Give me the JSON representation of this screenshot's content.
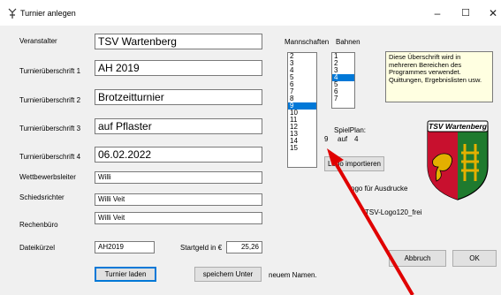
{
  "window": {
    "title": "Turnier anlegen",
    "min_glyph": "–",
    "max_glyph": "☐",
    "close_glyph": "✕"
  },
  "form": {
    "veranstalter": {
      "label": "Veranstalter",
      "value": "TSV Wartenberg"
    },
    "ueberschrift1": {
      "label": "Turnierüberschrift 1",
      "value": "AH 2019"
    },
    "ueberschrift2": {
      "label": "Turnierüberschrift 2",
      "value": "Brotzeitturnier"
    },
    "ueberschrift3": {
      "label": "Turnierüberschrift 3",
      "value": "auf Pflaster"
    },
    "ueberschrift4": {
      "label": "Turnierüberschrift 4",
      "value": "06.02.2022"
    },
    "wettbewerbsleiter": {
      "label": "Wettbewerbsleiter",
      "value": "Willi"
    },
    "schiedsrichter": {
      "label": "Schiedsrichter",
      "value": "Willi Veit"
    },
    "rechenbuero": {
      "label": "Rechenbüro",
      "value": "Willi Veit"
    },
    "dateikuerzel": {
      "label": "Dateikürzel",
      "value": "AH2019"
    },
    "startgeld": {
      "label": "Startgeld in €",
      "value": "25,26"
    }
  },
  "mannschaften": {
    "label": "Mannschaften",
    "items": [
      "2",
      "3",
      "4",
      "5",
      "6",
      "7",
      "8",
      "9",
      "10",
      "11",
      "12",
      "13",
      "14",
      "15"
    ],
    "selected": "9"
  },
  "bahnen": {
    "label": "Bahnen",
    "items": [
      "1",
      "2",
      "3",
      "4",
      "5",
      "6",
      "7"
    ],
    "selected": "4"
  },
  "note": "Diese Überschrift wird in mehreren Bereichen des Programmes verwendet. Quittungen, Ergebnislisten usw.",
  "spielplan": {
    "label": "SpielPlan:",
    "teams": "9",
    "auf": "auf",
    "lanes": "4"
  },
  "logo": {
    "import_button": "Logo importieren",
    "caption": "Logo für Ausdrucke",
    "visible_caption": "ogo für Ausdrucke",
    "filename": "TSV-Logo120_frei",
    "visible_filename": "TSV-Logo120_frei",
    "banner_text": "TSV Wartenberg",
    "colors": {
      "green": "#1f7a2e",
      "red": "#c8102e",
      "gold": "#e3b000"
    }
  },
  "buttons": {
    "turnier_laden": "Turnier laden",
    "speichern_unter": "speichern Unter",
    "neuem_namen": "neuem Namen.",
    "abbruch": "Abbruch",
    "ok": "OK"
  },
  "colors": {
    "selection": "#0078d7",
    "annotation_arrow": "#e00000"
  }
}
